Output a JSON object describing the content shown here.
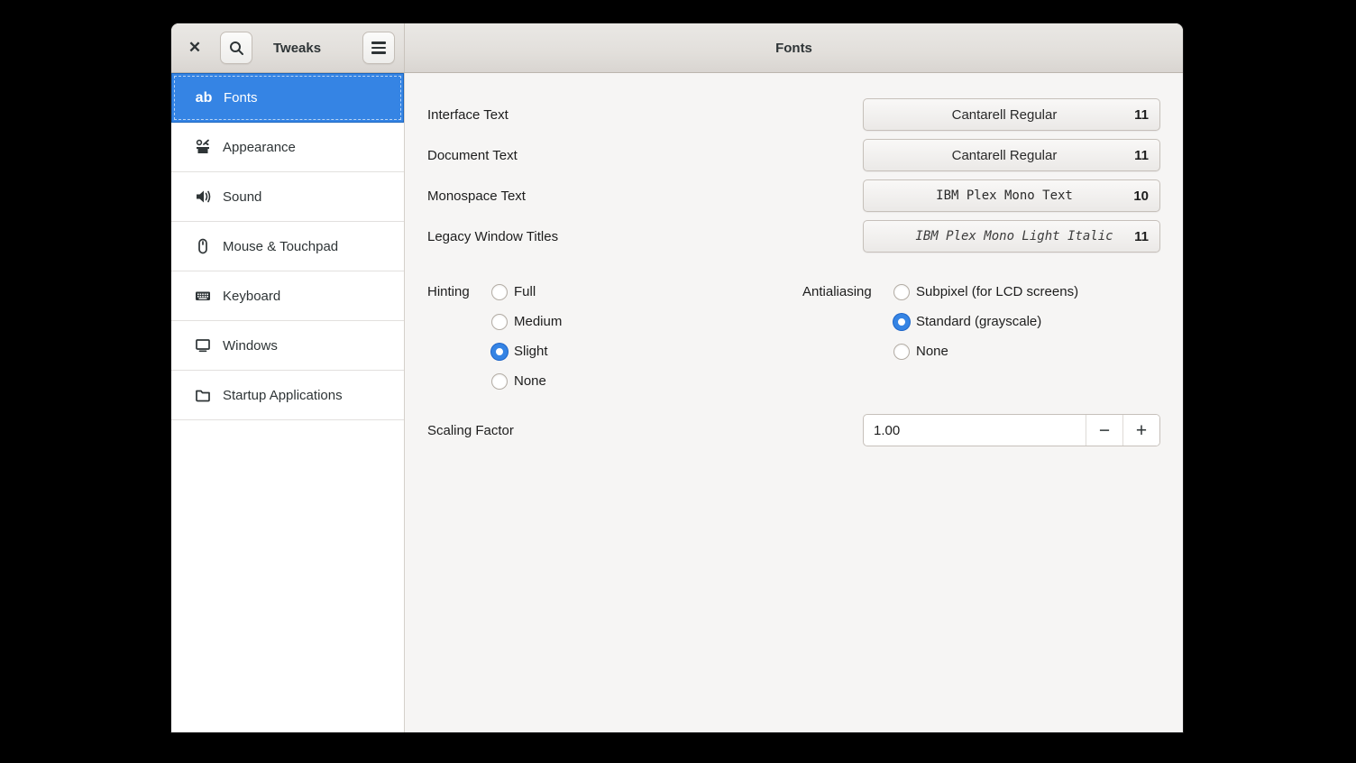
{
  "header": {
    "app_title": "Tweaks",
    "page_title": "Fonts",
    "close_glyph": "✕"
  },
  "sidebar": {
    "items": [
      {
        "label": "Fonts",
        "icon": "ab-icon",
        "selected": true
      },
      {
        "label": "Appearance",
        "icon": "appearance-icon",
        "selected": false
      },
      {
        "label": "Sound",
        "icon": "sound-icon",
        "selected": false
      },
      {
        "label": "Mouse & Touchpad",
        "icon": "mouse-icon",
        "selected": false
      },
      {
        "label": "Keyboard",
        "icon": "keyboard-icon",
        "selected": false
      },
      {
        "label": "Windows",
        "icon": "windows-icon",
        "selected": false
      },
      {
        "label": "Startup Applications",
        "icon": "startup-applications-icon",
        "selected": false
      }
    ],
    "ab_glyph": "ab"
  },
  "fonts_page": {
    "font_rows": [
      {
        "label": "Interface Text",
        "font_name": "Cantarell Regular",
        "size": "11",
        "style": "sans"
      },
      {
        "label": "Document Text",
        "font_name": "Cantarell Regular",
        "size": "11",
        "style": "sans"
      },
      {
        "label": "Monospace Text",
        "font_name": "IBM Plex Mono Text",
        "size": "10",
        "style": "mono"
      },
      {
        "label": "Legacy Window Titles",
        "font_name": "IBM Plex Mono Light Italic",
        "size": "11",
        "style": "mono-italic"
      }
    ],
    "hinting": {
      "label": "Hinting",
      "options": [
        {
          "label": "Full",
          "selected": false
        },
        {
          "label": "Medium",
          "selected": false
        },
        {
          "label": "Slight",
          "selected": true
        },
        {
          "label": "None",
          "selected": false
        }
      ]
    },
    "antialiasing": {
      "label": "Antialiasing",
      "options": [
        {
          "label": "Subpixel (for LCD screens)",
          "selected": false
        },
        {
          "label": "Standard (grayscale)",
          "selected": true
        },
        {
          "label": "None",
          "selected": false
        }
      ]
    },
    "scaling": {
      "label": "Scaling Factor",
      "value": "1.00",
      "minus_glyph": "−",
      "plus_glyph": "+"
    }
  },
  "colors": {
    "accent": "#3584e4",
    "header_bg": "#e2dfdb",
    "sidebar_bg": "#ffffff",
    "content_bg": "#f6f5f4",
    "selected_text": "#ffffff"
  }
}
